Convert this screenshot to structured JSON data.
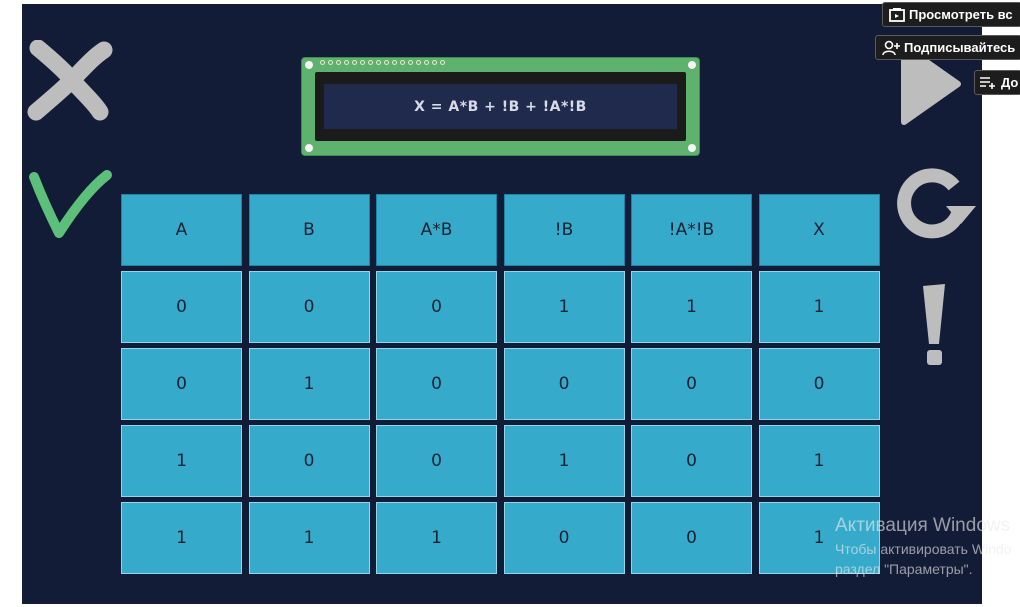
{
  "lcd": {
    "expression": "X = A*B + !B + !A*!B"
  },
  "table": {
    "headers": [
      "A",
      "B",
      "A*B",
      "!B",
      "!A*!B",
      "X"
    ],
    "rows": [
      [
        "0",
        "0",
        "0",
        "1",
        "1",
        "1"
      ],
      [
        "0",
        "1",
        "0",
        "0",
        "0",
        "0"
      ],
      [
        "1",
        "0",
        "0",
        "1",
        "0",
        "1"
      ],
      [
        "1",
        "1",
        "1",
        "0",
        "0",
        "1"
      ]
    ]
  },
  "controls": {
    "left": [
      {
        "name": "close-icon",
        "color": "#bdbdbd"
      },
      {
        "name": "check-icon",
        "color": "#5cc07a"
      }
    ],
    "right": [
      {
        "name": "play-icon",
        "color": "#bdbdbd"
      },
      {
        "name": "restart-icon",
        "color": "#bdbdbd"
      },
      {
        "name": "hint-icon",
        "color": "#bdbdbd"
      }
    ]
  },
  "overlay": {
    "watch_label": "Просмотреть вс",
    "subscribe_label": "Подписывайтесь",
    "add_label": "До"
  },
  "watermark": {
    "title": "Активация Windows",
    "line1": "Чтобы активировать Windo",
    "line2": "раздел \"Параметры\"."
  },
  "colors": {
    "background": "#131c36",
    "cell": "#36aaca",
    "lcd_board": "#5fb26e",
    "lcd_screen": "#1f2a4d"
  }
}
